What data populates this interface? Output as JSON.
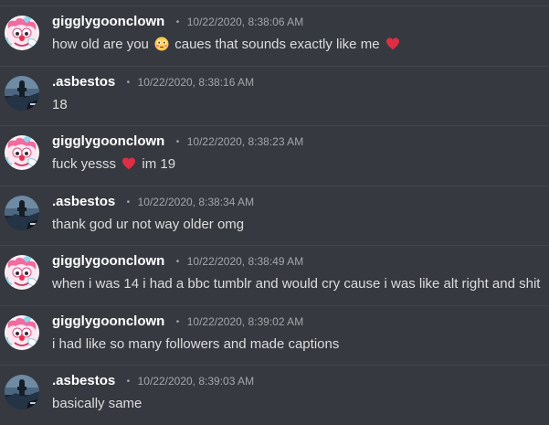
{
  "users": {
    "clown": {
      "name": "gigglygoonclown",
      "avatar_icon": "clown-avatar-icon"
    },
    "asbestos": {
      "name": ".asbestos",
      "avatar_icon": "landscape-avatar-icon"
    }
  },
  "separator_glyph": "•",
  "colors": {
    "background": "#36393f",
    "username": "#ffffff",
    "text": "#dcddde",
    "timestamp": "#a3a6aa",
    "heart": "#dd2e44"
  },
  "messages": [
    {
      "author": "gigglygoonclown",
      "timestamp": "10/22/2020, 8:38:06 AM",
      "text_before": "how old are you",
      "emoji": "flushed-face-icon",
      "text_after": "caues that sounds exactly like me",
      "emoji_end": "heart-icon"
    },
    {
      "author": ".asbestos",
      "timestamp": "10/22/2020, 8:38:16 AM",
      "text": "18"
    },
    {
      "author": "gigglygoonclown",
      "timestamp": "10/22/2020, 8:38:23 AM",
      "text_before": "fuck yesss",
      "emoji": "heart-icon",
      "text_after": "im 19"
    },
    {
      "author": ".asbestos",
      "timestamp": "10/22/2020, 8:38:34 AM",
      "text": "thank god ur not way older omg"
    },
    {
      "author": "gigglygoonclown",
      "timestamp": "10/22/2020, 8:38:49 AM",
      "text": "when i was 14 i had a bbc tumblr and would cry cause i was like alt right and shit"
    },
    {
      "author": "gigglygoonclown",
      "timestamp": "10/22/2020, 8:39:02 AM",
      "text": "i had like so many followers and made captions"
    },
    {
      "author": ".asbestos",
      "timestamp": "10/22/2020, 8:39:03 AM",
      "text": "basically same"
    }
  ]
}
